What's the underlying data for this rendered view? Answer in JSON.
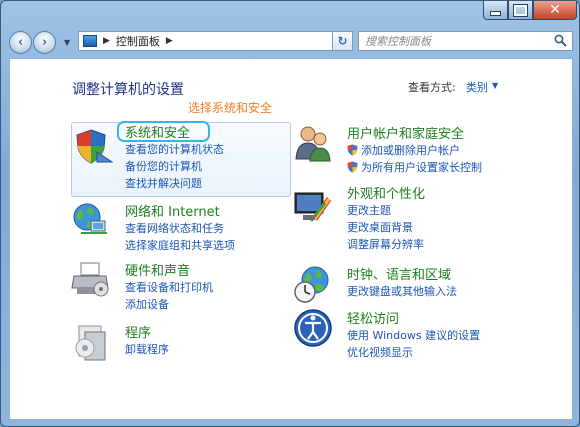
{
  "toolbar": {
    "breadcrumb_root": "控制面板",
    "search_placeholder": "搜索控制面板"
  },
  "view": {
    "label": "查看方式:",
    "value": "类别"
  },
  "page": {
    "title": "调整计算机的设置",
    "hint": "选择系统和安全"
  },
  "categories": [
    {
      "id": "system-security",
      "title": "系统和安全",
      "links": [
        "查看您的计算机状态",
        "备份您的计算机",
        "查找并解决问题"
      ]
    },
    {
      "id": "network",
      "title": "网络和 Internet",
      "links": [
        "查看网络状态和任务",
        "选择家庭组和共享选项"
      ]
    },
    {
      "id": "hardware",
      "title": "硬件和声音",
      "links": [
        "查看设备和打印机",
        "添加设备"
      ]
    },
    {
      "id": "programs",
      "title": "程序",
      "links": [
        "卸载程序"
      ]
    },
    {
      "id": "user-accounts",
      "title": "用户帐户和家庭安全",
      "links": [
        "添加或删除用户帐户",
        "为所有用户设置家长控制"
      ]
    },
    {
      "id": "appearance",
      "title": "外观和个性化",
      "links": [
        "更改主题",
        "更改桌面背景",
        "调整屏幕分辨率"
      ]
    },
    {
      "id": "clock",
      "title": "时钟、语言和区域",
      "links": [
        "更改键盘或其他输入法"
      ]
    },
    {
      "id": "ease",
      "title": "轻松访问",
      "links": [
        "使用 Windows 建议的设置",
        "优化视频显示"
      ]
    }
  ],
  "colors": {
    "heading": "#1e7f1e",
    "link": "#1c56b5",
    "title": "#1e3287",
    "hint": "#f47e21",
    "selection": "#36b5e8"
  }
}
